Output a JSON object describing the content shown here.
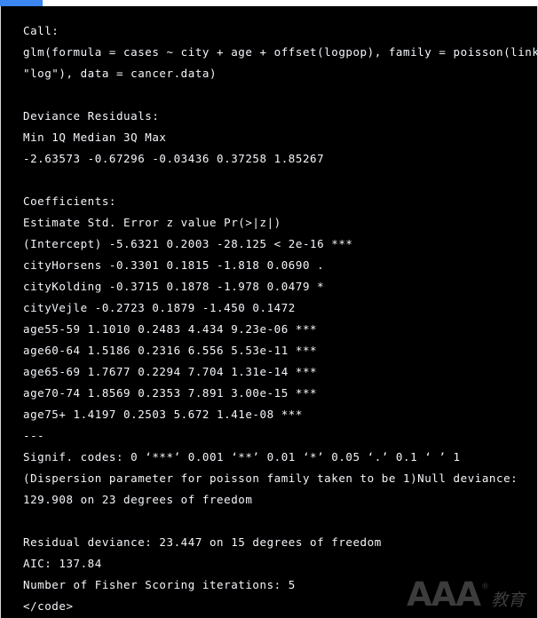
{
  "topbar": {
    "accent_color": "#3b86f0",
    "background_color": "#ffffff"
  },
  "console": {
    "background_color": "#000000",
    "text_color": "#f4f6fb",
    "lines": [
      "Call:",
      "glm(formula = cases ~ city + age + offset(logpop), family = poisson(link =",
      "\"log\"), data = cancer.data)",
      "",
      "Deviance Residuals:",
      "Min 1Q Median 3Q Max",
      "-2.63573 -0.67296 -0.03436 0.37258 1.85267",
      "",
      "Coefficients:",
      "Estimate Std. Error z value Pr(>|z|)",
      "(Intercept) -5.6321 0.2003 -28.125 < 2e-16 ***",
      "cityHorsens -0.3301 0.1815 -1.818 0.0690 .",
      "cityKolding -0.3715 0.1878 -1.978 0.0479 *",
      "cityVejle -0.2723 0.1879 -1.450 0.1472",
      "age55-59 1.1010 0.2483 4.434 9.23e-06 ***",
      "age60-64 1.5186 0.2316 6.556 5.53e-11 ***",
      "age65-69 1.7677 0.2294 7.704 1.31e-14 ***",
      "age70-74 1.8569 0.2353 7.891 3.00e-15 ***",
      "age75+ 1.4197 0.2503 5.672 1.41e-08 ***",
      "---",
      "Signif. codes: 0 ‘***’ 0.001 ‘**’ 0.01 ‘*’ 0.05 ‘.’ 0.1 ‘ ’ 1",
      "(Dispersion parameter for poisson family taken to be 1)Null deviance:",
      "129.908 on 23 degrees of freedom",
      "",
      "Residual deviance: 23.447 on 15 degrees of freedom",
      "AIC: 137.84",
      "Number of Fisher Scoring iterations: 5",
      "</code>"
    ]
  },
  "model_summary": {
    "call": "glm(formula = cases ~ city + age + offset(logpop), family = poisson(link = \"log\"), data = cancer.data)",
    "deviance_residuals": {
      "headers": [
        "Min",
        "1Q",
        "Median",
        "3Q",
        "Max"
      ],
      "values": [
        "-2.63573",
        "-0.67296",
        "-0.03436",
        "0.37258",
        "1.85267"
      ]
    },
    "coefficients": {
      "headers": [
        "",
        "Estimate",
        "Std. Error",
        "z value",
        "Pr(>|z|)",
        ""
      ],
      "rows": [
        [
          "(Intercept)",
          "-5.6321",
          "0.2003",
          "-28.125",
          "< 2e-16",
          "***"
        ],
        [
          "cityHorsens",
          "-0.3301",
          "0.1815",
          "-1.818",
          "0.0690",
          "."
        ],
        [
          "cityKolding",
          "-0.3715",
          "0.1878",
          "-1.978",
          "0.0479",
          "*"
        ],
        [
          "cityVejle",
          "-0.2723",
          "0.1879",
          "-1.450",
          "0.1472",
          ""
        ],
        [
          "age55-59",
          "1.1010",
          "0.2483",
          "4.434",
          "9.23e-06",
          "***"
        ],
        [
          "age60-64",
          "1.5186",
          "0.2316",
          "6.556",
          "5.53e-11",
          "***"
        ],
        [
          "age65-69",
          "1.7677",
          "0.2294",
          "7.704",
          "1.31e-14",
          "***"
        ],
        [
          "age70-74",
          "1.8569",
          "0.2353",
          "7.891",
          "3.00e-15",
          "***"
        ],
        [
          "age75+",
          "1.4197",
          "0.2503",
          "5.672",
          "1.41e-08",
          "***"
        ]
      ]
    },
    "signif_codes": "0 ‘***’ 0.001 ‘**’ 0.01 ‘*’ 0.05 ‘.’ 0.1 ‘ ’ 1",
    "dispersion": "(Dispersion parameter for poisson family taken to be 1)",
    "null_deviance": "129.908 on 23 degrees of freedom",
    "residual_deviance": "23.447 on 15 degrees of freedom",
    "aic": "137.84",
    "fisher_iterations": "5",
    "closing_tag": "</code>"
  },
  "watermark": {
    "brand": "AAA",
    "registered_mark": "®",
    "subtitle": "教育",
    "color": "#3c3c3c"
  }
}
